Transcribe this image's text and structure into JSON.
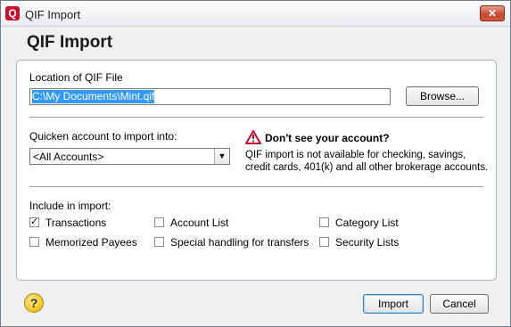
{
  "window": {
    "title": "QIF Import",
    "app_icon": "Q",
    "close_glyph": "✕"
  },
  "heading": "QIF Import",
  "file_location": {
    "label": "Location of QIF File",
    "value": "C:\\My Documents\\Mint.qif",
    "browse_label": "Browse..."
  },
  "account": {
    "label": "Quicken account to import into:",
    "selected": "<All Accounts>"
  },
  "warning": {
    "title": "Don't see your account?",
    "body": "QIF import is not available for checking, savings, credit cards, 401(k) and all other brokerage accounts."
  },
  "include": {
    "label": "Include in import:",
    "options": [
      {
        "label": "Transactions",
        "checked": true
      },
      {
        "label": "Account List",
        "checked": false
      },
      {
        "label": "Category List",
        "checked": false
      },
      {
        "label": "Memorized Payees",
        "checked": false
      },
      {
        "label": "Special handling for transfers",
        "checked": false
      },
      {
        "label": "Security Lists",
        "checked": false
      }
    ]
  },
  "footer": {
    "help_glyph": "?",
    "import_label": "Import",
    "cancel_label": "Cancel"
  },
  "colors": {
    "close_red": "#c7452d",
    "selection_blue": "#3399ff",
    "warning_red": "#c8102e",
    "help_yellow": "#f2c21d"
  }
}
